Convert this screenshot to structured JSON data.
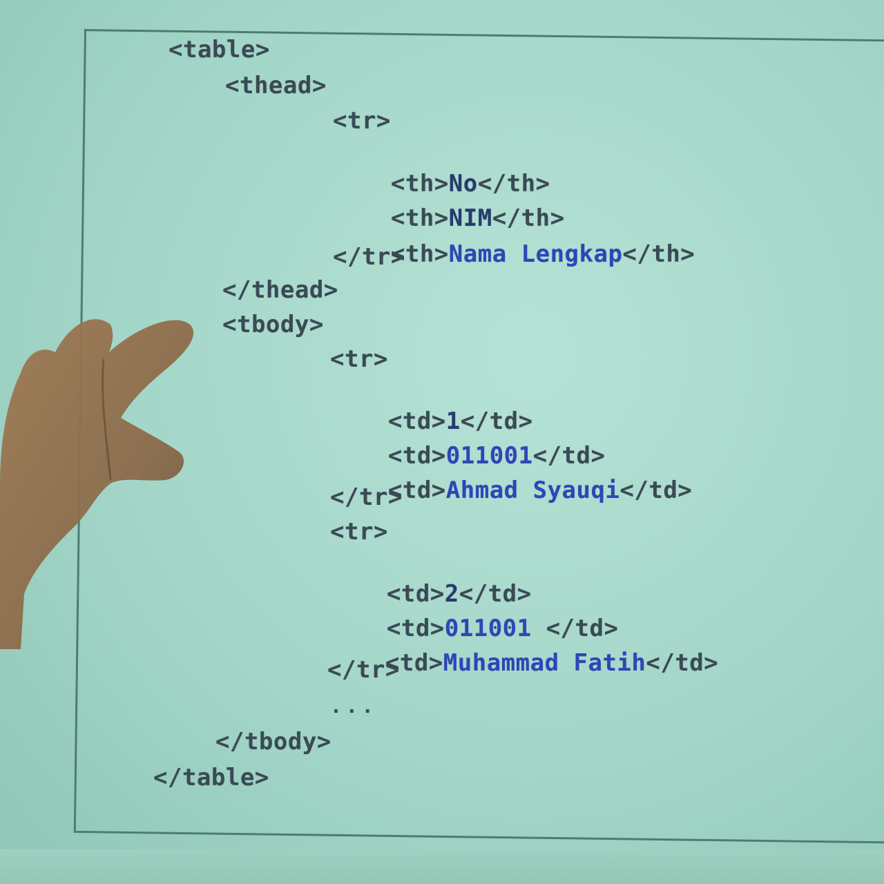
{
  "code": {
    "line_table_open": "<table>",
    "line_thead_open": "<thead>",
    "line_tr1_open": "<tr>",
    "line_th_no": {
      "open": "<th>",
      "text": "No",
      "close": "</th>"
    },
    "line_th_nim": {
      "open": "<th>",
      "text": "NIM",
      "close": "</th>"
    },
    "line_th_nama": {
      "open": "<th>",
      "text": "Nama Lengkap",
      "close": "</th>"
    },
    "line_tr1_close": "</tr>",
    "line_thead_close": "</thead>",
    "line_tbody_open": "<tbody>",
    "line_tr2_open": "<tr>",
    "line_td_1": {
      "open": "<td>",
      "text": "1",
      "close": "</td>"
    },
    "line_td_nim1": {
      "open": "<td>",
      "text": "011001",
      "close": "</td>"
    },
    "line_td_name1": {
      "open": "<td>",
      "text": "Ahmad Syauqi",
      "close": "</td>"
    },
    "line_tr2_close": "</tr>",
    "line_tr3_open": "<tr>",
    "line_td_2": {
      "open": "<td>",
      "text": "2",
      "close": "</td>"
    },
    "line_td_nim2": {
      "open": "<td>",
      "text": "011001 ",
      "close": "</td>"
    },
    "line_td_name2": {
      "open": "<td>",
      "text": "Muhammad Fatih",
      "close": "</td>"
    },
    "line_tr3_close": "</tr>",
    "line_ellipsis": "...",
    "line_tbody_close": "</tbody>",
    "line_table_close": "</table>"
  },
  "colors": {
    "background": "#a3d6c8",
    "frame": "#4d7c73",
    "tag": "#3a4a55",
    "content": "#2f45b8",
    "skin": "#8a6a4a"
  }
}
